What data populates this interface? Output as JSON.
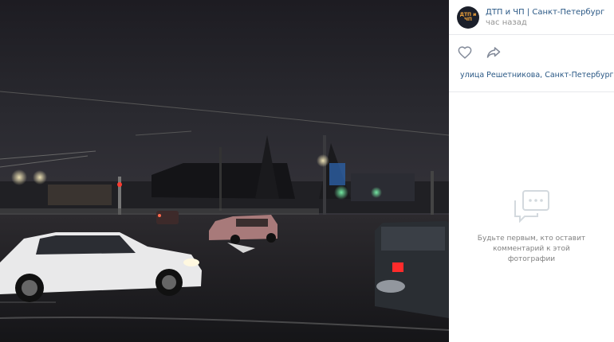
{
  "post": {
    "group_name": "ДТП и ЧП | Санкт-Петербург | Питер Онлайн",
    "time": "час назад",
    "avatar_text": "ДТП и ЧП",
    "location": "улица Решетникова, Санкт-Петербург"
  },
  "actions": [
    {
      "icon": "heart-icon",
      "label": "like"
    },
    {
      "icon": "share-icon",
      "label": "share"
    }
  ],
  "comments": {
    "empty_text": "Будьте первым, кто оставит комментарий к этой фотографии"
  },
  "colors": {
    "link": "#2a5885",
    "muted": "#939393",
    "icon": "#828a99"
  }
}
